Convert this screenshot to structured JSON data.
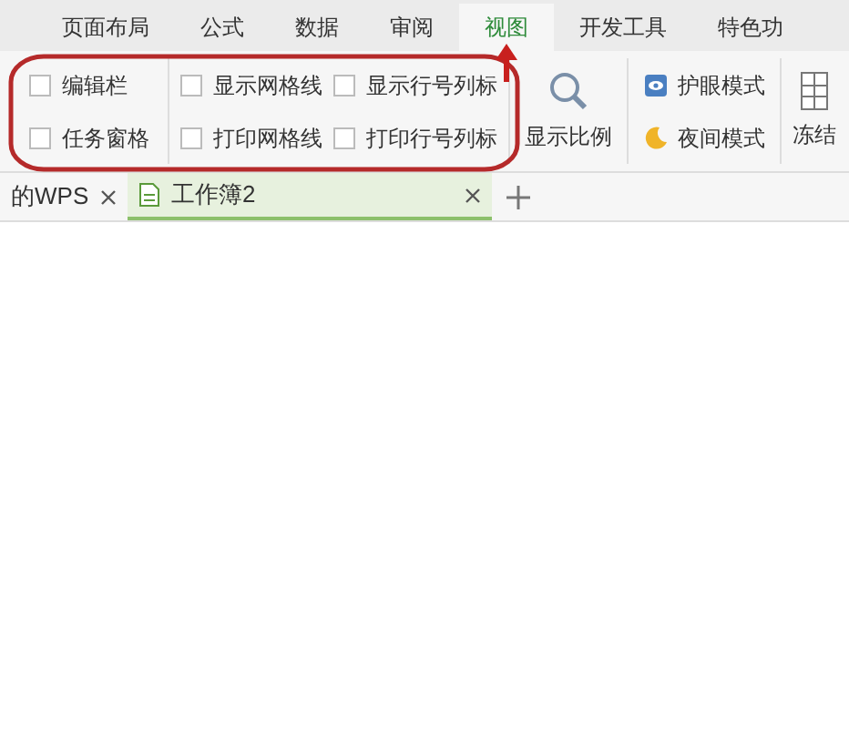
{
  "menu_tabs": [
    {
      "label": "页面布局",
      "selected": false
    },
    {
      "label": "公式",
      "selected": false
    },
    {
      "label": "数据",
      "selected": false
    },
    {
      "label": "审阅",
      "selected": false
    },
    {
      "label": "视图",
      "selected": true
    },
    {
      "label": "开发工具",
      "selected": false
    },
    {
      "label": "特色功",
      "selected": false
    }
  ],
  "checkbox_columns": [
    [
      {
        "label": "编辑栏",
        "checked": false
      },
      {
        "label": "任务窗格",
        "checked": false
      }
    ],
    [
      {
        "label": "显示网格线",
        "checked": false
      },
      {
        "label": "打印网格线",
        "checked": false
      }
    ],
    [
      {
        "label": "显示行号列标",
        "checked": false
      },
      {
        "label": "打印行号列标",
        "checked": false
      }
    ]
  ],
  "zoom_button": {
    "label": "显示比例"
  },
  "modes": [
    {
      "kind": "eye",
      "label": "护眼模式"
    },
    {
      "kind": "night",
      "label": "夜间模式"
    }
  ],
  "freeze_button": {
    "label": "冻结"
  },
  "doc_tabs": [
    {
      "label": "的WPS",
      "selected": false
    },
    {
      "label": "工作簿2",
      "selected": true
    }
  ]
}
